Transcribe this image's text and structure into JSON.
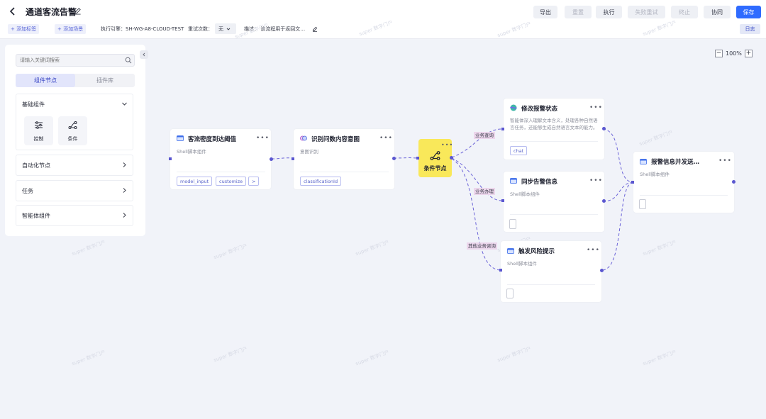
{
  "header": {
    "title": "通道客流告警",
    "buttons": {
      "export": "导出",
      "reset": "重置",
      "run": "执行",
      "retry_failed": "失败重试",
      "stop": "终止",
      "collab": "协同",
      "save": "保存"
    },
    "add_tag": "+ 添加标签",
    "add_scene": "+ 添加场景",
    "engine": "执行引擎：SH-WG-A8-CLOUD-TEST",
    "retry_label": "重试次数：",
    "retry_value": "无",
    "desc": "描述：  该流程用于返回文…",
    "log": "日志",
    "zoom": "100%"
  },
  "sidebar": {
    "search_placeholder": "请输入关键词搜索",
    "tabs": [
      "组件节点",
      "插件库"
    ],
    "sections": {
      "basic": "基础组件",
      "automation": "自动化节点",
      "task": "任务",
      "agent": "智能体组件"
    },
    "components": [
      "控制",
      "条件"
    ]
  },
  "watermark": "super 数字门户",
  "nodes": {
    "n1": {
      "title": "客流密度到达阈值",
      "sub": "Shell脚本组件",
      "params": [
        "model_input",
        "customize",
        ">"
      ]
    },
    "n2": {
      "title": "识别问数内容意图",
      "sub": "意图识别",
      "params": [
        "classificationId"
      ]
    },
    "cond": {
      "title": "条件节点"
    },
    "n3": {
      "title": "修改报警状态",
      "desc": "智能体深入理解文本含义，处理各种自然语言任务，还能够生成自然语言文本的能力。",
      "params": [
        "chat"
      ]
    },
    "n4": {
      "title": "同步告警信息",
      "sub": "Shell脚本组件"
    },
    "n5": {
      "title": "触发风险提示",
      "sub": "Shell脚本组件"
    },
    "n6": {
      "title": "报警信息并发送…",
      "sub": "Shell脚本组件"
    }
  },
  "edge_labels": [
    "业务查询",
    "业务办理",
    "其他业务咨询"
  ],
  "colors": {
    "accent": "#2f6bff",
    "edge": "#6b63d8",
    "condition": "#f9e85a"
  }
}
